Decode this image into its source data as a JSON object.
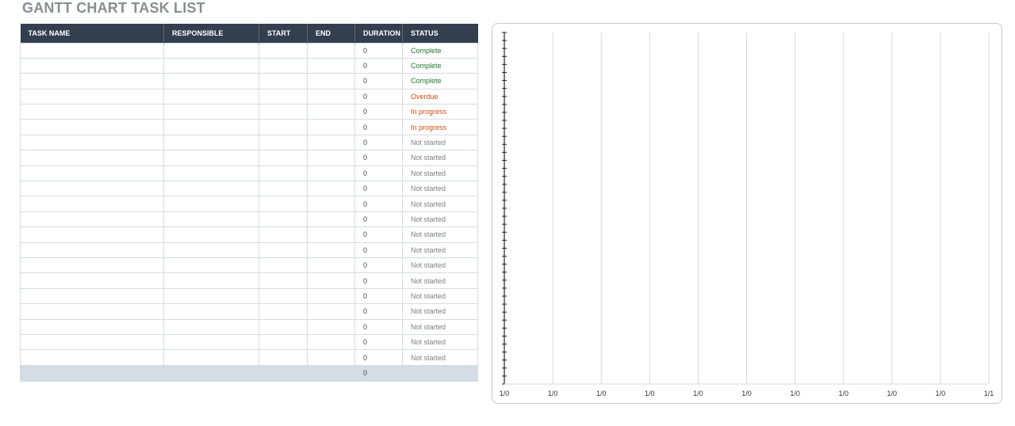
{
  "page": {
    "title": "GANTT CHART TASK LIST"
  },
  "table": {
    "headers": [
      "TASK NAME",
      "RESPONSIBLE",
      "START",
      "END",
      "DURATION",
      "STATUS"
    ],
    "rows": [
      {
        "duration": "0",
        "status": "Complete"
      },
      {
        "duration": "0",
        "status": "Complete"
      },
      {
        "duration": "0",
        "status": "Complete"
      },
      {
        "duration": "0",
        "status": "Overdue"
      },
      {
        "duration": "0",
        "status": "In progress"
      },
      {
        "duration": "0",
        "status": "In progress"
      },
      {
        "duration": "0",
        "status": "Not started"
      },
      {
        "duration": "0",
        "status": "Not started"
      },
      {
        "duration": "0",
        "status": "Not started"
      },
      {
        "duration": "0",
        "status": "Not started"
      },
      {
        "duration": "0",
        "status": "Not started"
      },
      {
        "duration": "0",
        "status": "Not started"
      },
      {
        "duration": "0",
        "status": "Not started"
      },
      {
        "duration": "0",
        "status": "Not started"
      },
      {
        "duration": "0",
        "status": "Not started"
      },
      {
        "duration": "0",
        "status": "Not started"
      },
      {
        "duration": "0",
        "status": "Not started"
      },
      {
        "duration": "0",
        "status": "Not started"
      },
      {
        "duration": "0",
        "status": "Not started"
      },
      {
        "duration": "0",
        "status": "Not started"
      },
      {
        "duration": "0",
        "status": "Not started"
      }
    ],
    "total_duration": "0",
    "status_colors": {
      "Complete": "#1f7a2e",
      "Overdue": "#d64b10",
      "In progress": "#d64b10",
      "Not started": "#7a7f86"
    },
    "header_bg": "#333f4f"
  },
  "chart_data": {
    "type": "bar",
    "x_tick_labels": [
      "1/0",
      "1/0",
      "1/0",
      "1/0",
      "1/0",
      "1/0",
      "1/0",
      "1/0",
      "1/0",
      "1/0",
      "1/1"
    ],
    "categories": [],
    "series": [],
    "grid": true,
    "gridline_color": "#d9d9d9"
  }
}
